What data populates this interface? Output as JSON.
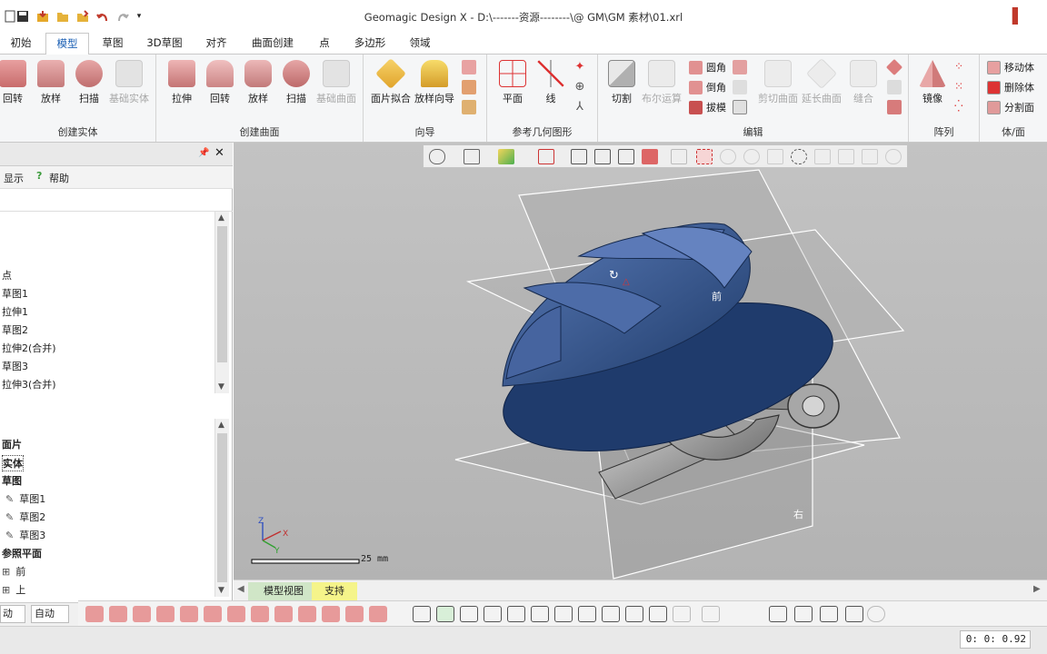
{
  "app": {
    "title": "Geomagic Design X - D:\\-------资源--------\\@ GM\\GM 素材\\01.xrl"
  },
  "menu_tabs": [
    "初始",
    "模型",
    "草图",
    "3D草图",
    "对齐",
    "曲面创建",
    "点",
    "多边形",
    "领域"
  ],
  "ribbon": {
    "groups": [
      "创建实体",
      "创建曲面",
      "向导",
      "参考几何图形",
      "编辑",
      "阵列",
      "体/面"
    ],
    "solid": [
      "回转",
      "放样",
      "扫描",
      "基础实体"
    ],
    "surface": [
      "拉伸",
      "回转",
      "放样",
      "扫描",
      "基础曲面"
    ],
    "wizard": [
      "面片拟合",
      "放样向导"
    ],
    "refgeom": [
      "平面",
      "线"
    ],
    "edit_main": [
      "切割",
      "布尔运算"
    ],
    "edit_small": [
      "圆角",
      "倒角",
      "拔模"
    ],
    "edit_dis": [
      "剪切曲面",
      "延长曲面",
      "缝合"
    ],
    "pattern": [
      "镜像"
    ],
    "body": [
      "移动体",
      "删除体",
      "分割面"
    ]
  },
  "left_panel": {
    "toolbar": {
      "display": "显示",
      "help": "帮助"
    },
    "feature_tree": [
      "点",
      "草图1",
      "拉伸1",
      "草图2",
      "拉伸2(合并)",
      "草图3",
      "拉伸3(合并)"
    ],
    "model_tree": {
      "sections": [
        "面片",
        "实体",
        "草图"
      ],
      "sketches": [
        "草图1",
        "草图2",
        "草图3"
      ],
      "refplanes_title": "参照平面",
      "refplanes": [
        "前",
        "上"
      ]
    },
    "bottom_combo_left": "动",
    "bottom_combo": "自动"
  },
  "viewport": {
    "plane_labels": {
      "front": "前",
      "right": "右"
    },
    "scale_label": "25 mm",
    "tabs": [
      "模型视图",
      "支持"
    ],
    "colors": {
      "model": "#2c4f86",
      "bg": "#bdbdbd",
      "accent_red": "#d83b3b"
    }
  },
  "status": {
    "coords": "0: 0: 0.92"
  }
}
